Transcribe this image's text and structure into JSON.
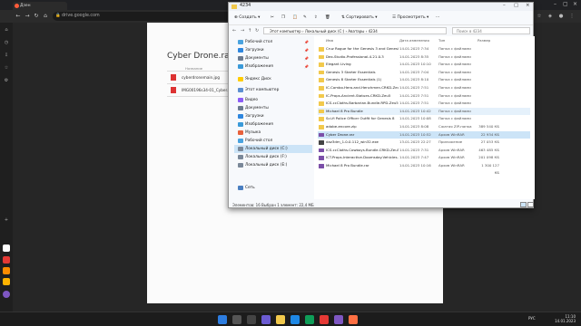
{
  "browser": {
    "tab_title": "Дзен",
    "address": "drive.google.com"
  },
  "document": {
    "title": "Cyber Drone.rar",
    "column_header": "Название",
    "files": [
      "cyberdronemain.jpg",
      "IMG00196s34-01_Cyber..."
    ]
  },
  "explorer": {
    "window_title": "4234",
    "create_label": "Создать",
    "sort_label": "Сортировать",
    "view_label": "Просмотреть",
    "path": "Этот компьютер  ›  Локальный диск (C:)  ›  Аватары  ›  4234",
    "search_placeholder": "Поиск в 4234",
    "columns": {
      "name": "Имя",
      "date": "Дата изменения",
      "type": "Тип",
      "size": "Размер"
    },
    "nav_items": [
      {
        "label": "Рабочий стол",
        "icon": "desktop-icon",
        "color": "#4aa3df",
        "pinned": true
      },
      {
        "label": "Загрузки",
        "icon": "download-icon",
        "color": "#2e86de",
        "pinned": true
      },
      {
        "label": "Документы",
        "icon": "document-icon",
        "color": "#6b7a8f",
        "pinned": true
      },
      {
        "label": "Изображения",
        "icon": "image-icon",
        "color": "#3a9ad9",
        "pinned": true
      },
      {
        "label": "Яндекс Диск",
        "icon": "cloud-icon",
        "color": "#ffcc00",
        "pinned": false
      },
      {
        "label": "Этот компьютер",
        "icon": "computer-icon",
        "color": "#5b8fd1",
        "pinned": false
      },
      {
        "label": "Видео",
        "icon": "video-icon",
        "color": "#8b5cf6",
        "pinned": false
      },
      {
        "label": "Документы",
        "icon": "document-icon",
        "color": "#6b7a8f",
        "pinned": false
      },
      {
        "label": "Загрузки",
        "icon": "download-icon",
        "color": "#2e86de",
        "pinned": false
      },
      {
        "label": "Изображения",
        "icon": "image-icon",
        "color": "#3a9ad9",
        "pinned": false
      },
      {
        "label": "Музыка",
        "icon": "music-icon",
        "color": "#e8613c",
        "pinned": false
      },
      {
        "label": "Рабочий стол",
        "icon": "desktop-icon",
        "color": "#4aa3df",
        "pinned": false
      },
      {
        "label": "Локальный диск (C:)",
        "icon": "drive-icon",
        "color": "#7a8899",
        "pinned": false
      },
      {
        "label": "Локальный диск (F:)",
        "icon": "drive-icon",
        "color": "#7a8899",
        "pinned": false
      },
      {
        "label": "Локальный диск (E:)",
        "icon": "drive-icon",
        "color": "#7a8899",
        "pinned": false
      },
      {
        "label": "Сеть",
        "icon": "network-icon",
        "color": "#4a7fc1",
        "pinned": false
      }
    ],
    "rows": [
      {
        "name": "Cruz Rogue for the Genesis 3 and Genesis 8 M",
        "date": "14.01.2023 7:34",
        "type": "Папка с файлами",
        "size": "",
        "kind": "folder"
      },
      {
        "name": "Dex-Studio-Professional-4.21.0.3",
        "date": "14.01.2023 8:35",
        "type": "Папка с файлами",
        "size": "",
        "kind": "folder"
      },
      {
        "name": "Elegant Living",
        "date": "14.01.2023 10:10",
        "type": "Папка с файлами",
        "size": "",
        "kind": "folder"
      },
      {
        "name": "Genesis 3 Starter Essentials",
        "date": "14.01.2023 7:04",
        "type": "Папка с файлами",
        "size": "",
        "kind": "folder"
      },
      {
        "name": "Genesis 8 Starter Essentials (1)",
        "date": "14.01.2023 8:10",
        "type": "Папка с файлами",
        "size": "",
        "kind": "folder"
      },
      {
        "name": "IC.Combo.Hero.and.Henchmen.CRKD-Zeu5",
        "date": "14.01.2023 7:51",
        "type": "Папка с файлами",
        "size": "",
        "kind": "folder"
      },
      {
        "name": "IC.Props.Ancient.Statues.CRKD-Zeu5",
        "date": "14.01.2023 7:51",
        "type": "Папка с файлами",
        "size": "",
        "kind": "folder"
      },
      {
        "name": "ICS.ccCloths.Barbarian.Bundle.RPD-Zeu5",
        "date": "14.01.2023 7:51",
        "type": "Папка с файлами",
        "size": "",
        "kind": "folder"
      },
      {
        "name": "Michael 8 Pro Bundle",
        "date": "14.01.2023 10:42",
        "type": "Папка с файлами",
        "size": "",
        "kind": "folder"
      },
      {
        "name": "Sci-fi Police Officer Outfit for Genesis 8",
        "date": "14.01.2023 10:08",
        "type": "Папка с файлами",
        "size": "",
        "kind": "folder"
      },
      {
        "name": "adobe-encore.zip",
        "date": "14.01.2023 8:08",
        "type": "Сжатая ZIP-папка",
        "size": "389 540 КБ",
        "kind": "zip"
      },
      {
        "name": "Cyber Drone.rar",
        "date": "14.01.2023 10:52",
        "type": "Архив WinRAR",
        "size": "22 934 КБ",
        "kind": "rar"
      },
      {
        "name": "daz3dm_1.0.0.112_win32.exe",
        "date": "13.01.2023 22:27",
        "type": "Приложение",
        "size": "27 053 КБ",
        "kind": "exe"
      },
      {
        "name": "ICS.ccCloths.Cowboys.Bundle.CRKD-Zeu5.rar",
        "date": "14.01.2023 7:31",
        "type": "Архив WinRAR",
        "size": "463 485 КБ",
        "kind": "rar"
      },
      {
        "name": "ICT.Props.Interactive.Doomsday.Vehicles.CRKD-Zeu5.rar",
        "date": "14.01.2023 7:47",
        "type": "Архив WinRAR",
        "size": "201 098 КБ",
        "kind": "rar"
      },
      {
        "name": "Michael 8 Pro Bundle.rar",
        "date": "14.01.2023 10:16",
        "type": "Архив WinRAR",
        "size": "1 300 127 КБ",
        "kind": "rar"
      }
    ],
    "selected_row": 11,
    "hover_row": 8,
    "status_text": "Элементов: 16     Выбран 1 элемент: 22,4 МБ"
  },
  "colors": {
    "folder": "#f2c94c",
    "zip": "#f2c94c",
    "rar": "#7b4fa8",
    "exe": "#444",
    "selection": "#cce4f7"
  },
  "taskbar": {
    "time": "11:10",
    "date": "14.01.2023",
    "lang": "РУС"
  }
}
